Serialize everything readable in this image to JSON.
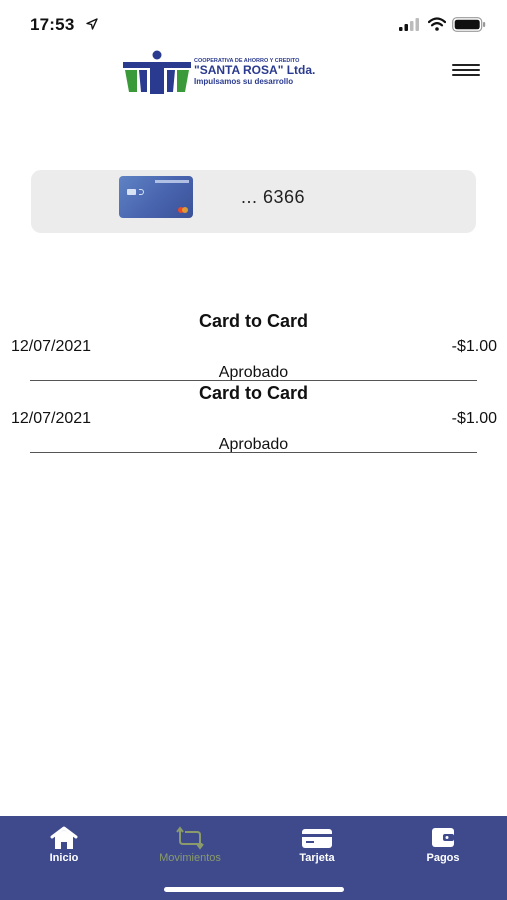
{
  "status_bar": {
    "time": "17:53",
    "icons": [
      "location-arrow-icon",
      "signal-icon",
      "wifi-icon",
      "battery-icon"
    ]
  },
  "header": {
    "logo": {
      "line1": "COOPERATIVA DE AHORRO Y CREDITO",
      "line2": "\"SANTA ROSA\" Ltda.",
      "line3": "Impulsamos su desarrollo"
    },
    "menu_icon": "hamburger-menu-icon"
  },
  "card_selector": {
    "masked_number": "... 6366"
  },
  "transactions": [
    {
      "title": "Card to Card",
      "date": "12/07/2021",
      "amount": "-$1.00",
      "status": "Aprobado"
    },
    {
      "title": "Card to Card",
      "date": "12/07/2021",
      "amount": "-$1.00",
      "status": "Aprobado"
    }
  ],
  "bottom_nav": {
    "items": [
      {
        "label": "Inicio",
        "icon": "home-icon",
        "active": false
      },
      {
        "label": "Movimientos",
        "icon": "transfer-arrows-icon",
        "active": true
      },
      {
        "label": "Tarjeta",
        "icon": "card-icon",
        "active": false
      },
      {
        "label": "Pagos",
        "icon": "wallet-icon",
        "active": false
      }
    ]
  },
  "colors": {
    "nav_background": "#3e4a8c",
    "nav_active": "#8a9a6a",
    "brand_blue": "#2a3a8f",
    "brand_green": "#3a9a3a"
  }
}
